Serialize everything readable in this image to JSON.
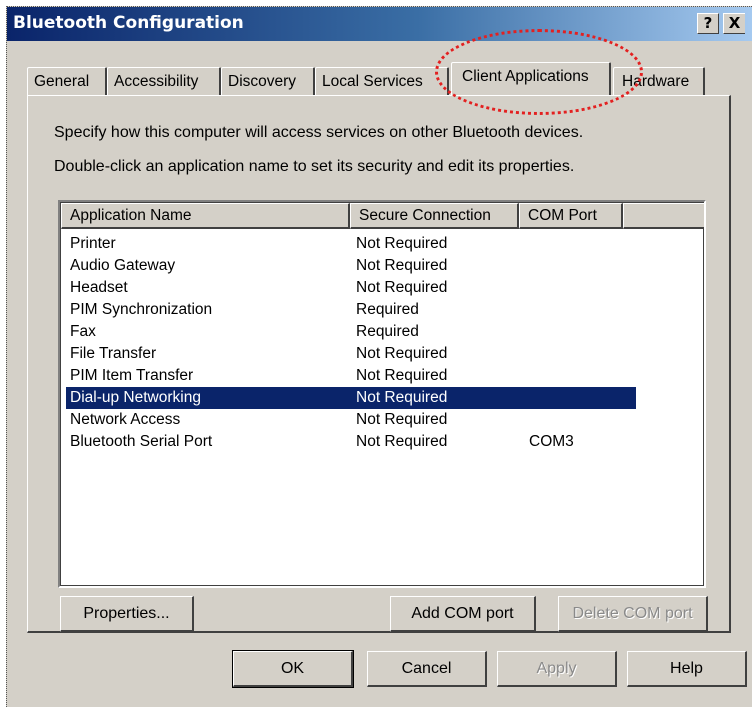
{
  "window": {
    "title": "Bluetooth Configuration",
    "help_button": "?",
    "close_button": "X"
  },
  "tabs": [
    {
      "label": "General",
      "active": false
    },
    {
      "label": "Accessibility",
      "active": false
    },
    {
      "label": "Discovery",
      "active": false
    },
    {
      "label": "Local Services",
      "active": false
    },
    {
      "label": "Client Applications",
      "active": true
    },
    {
      "label": "Hardware",
      "active": false
    }
  ],
  "panel": {
    "description_1": "Specify how this computer will access services on other Bluetooth devices.",
    "description_2": "Double-click an application name to set its security and edit its properties."
  },
  "list": {
    "columns": [
      "Application Name",
      "Secure Connection",
      "COM Port"
    ],
    "rows": [
      {
        "name": "Printer",
        "secure": "Not Required",
        "com": ""
      },
      {
        "name": "Audio Gateway",
        "secure": "Not Required",
        "com": ""
      },
      {
        "name": "Headset",
        "secure": "Not Required",
        "com": ""
      },
      {
        "name": "PIM Synchronization",
        "secure": "Required",
        "com": ""
      },
      {
        "name": "Fax",
        "secure": "Required",
        "com": ""
      },
      {
        "name": "File Transfer",
        "secure": "Not Required",
        "com": ""
      },
      {
        "name": "PIM Item Transfer",
        "secure": "Not Required",
        "com": ""
      },
      {
        "name": "Dial-up Networking",
        "secure": "Not Required",
        "com": "",
        "selected": true
      },
      {
        "name": "Network Access",
        "secure": "Not Required",
        "com": ""
      },
      {
        "name": "Bluetooth Serial Port",
        "secure": "Not Required",
        "com": "COM3"
      }
    ]
  },
  "panel_buttons": {
    "properties": "Properties...",
    "add_com_port": "Add COM port",
    "delete_com_port": "Delete COM port"
  },
  "dialog_buttons": {
    "ok": "OK",
    "cancel": "Cancel",
    "apply": "Apply",
    "help": "Help"
  },
  "colors": {
    "title_bar": "#0a246a",
    "selection": "#0a246a",
    "annotation": "#e32020",
    "face": "#d4d0c8"
  }
}
